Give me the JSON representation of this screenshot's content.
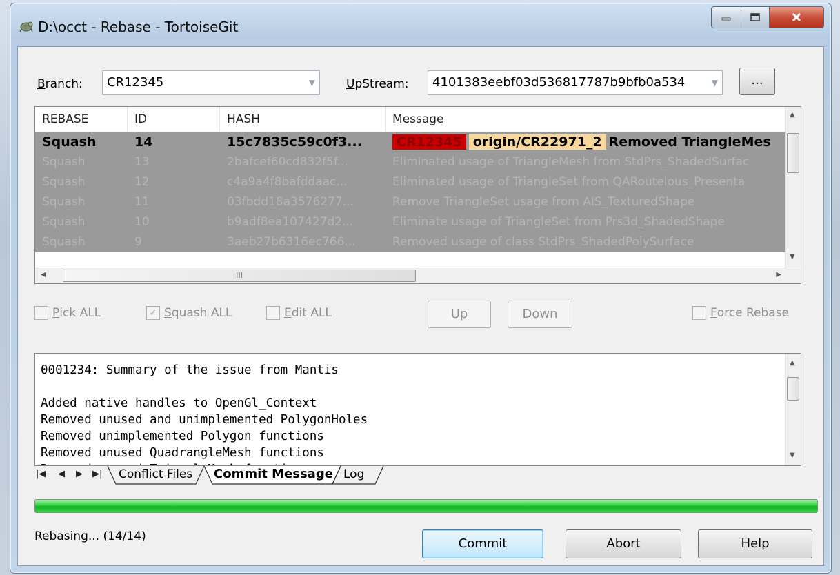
{
  "window": {
    "title": "D:\\occt - Rebase - TortoiseGit",
    "controls": {
      "minimize": "–",
      "maximize": "□",
      "close": "X"
    }
  },
  "branch": {
    "label_u": "B",
    "label_rest": "ranch:",
    "value": "CR12345"
  },
  "upstream": {
    "label_u": "U",
    "label_rest": "pStream:",
    "value": "4101383eebf03d536817787b9bfb0a534",
    "browse_label": "..."
  },
  "list": {
    "columns": [
      "REBASE",
      "ID",
      "HASH",
      "Message"
    ],
    "rows": [
      {
        "action": "Squash",
        "id": "14",
        "hash": "15c7835c59c0f3...",
        "tag1": "CR12345",
        "tag2": "origin/CR22971_2",
        "message": "Removed TriangleMes"
      },
      {
        "action": "Squash",
        "id": "13",
        "hash": "2bafcef60cd832f5f...",
        "message": "Eliminated usage of TriangleMesh from StdPrs_ShadedSurfac"
      },
      {
        "action": "Squash",
        "id": "12",
        "hash": "c4a9a4f8bafddaac...",
        "message": "Eliminated usage of TriangleSet from  QARoutelous_Presenta"
      },
      {
        "action": "Squash",
        "id": "11",
        "hash": "03fbdd18a3576277...",
        "message": "Remove TriangleSet usage from AIS_TexturedShape"
      },
      {
        "action": "Squash",
        "id": "10",
        "hash": "b9adf8ea107427d2...",
        "message": "Eliminate usage of TriangleSet from Prs3d_ShadedShape"
      },
      {
        "action": "Squash",
        "id": "9",
        "hash": "3aeb27b6316ec766...",
        "message": "Removed usage of class StdPrs_ShadedPolySurface"
      }
    ],
    "hscroll_marker": "III"
  },
  "options": {
    "pick_all": {
      "u": "P",
      "rest": "ick ALL"
    },
    "squash_all": {
      "u": "S",
      "rest": "quash ALL"
    },
    "edit_all": {
      "u": "E",
      "rest": "dit ALL"
    },
    "up_label": "Up",
    "down_label": "Down",
    "force_rebase": {
      "u": "F",
      "rest": "orce Rebase"
    }
  },
  "commit_message": {
    "text": "0001234: Summary of the issue from Mantis\n\nAdded native handles to OpenGl_Context\nRemoved unused and unimplemented PolygonHoles\nRemoved unimplemented Polygon functions\nRemoved unused QuadrangleMesh functions\nRemoved unused TriangleMesh functions"
  },
  "tabs": {
    "nav": [
      "|◀",
      "◀",
      "▶",
      "▶|"
    ],
    "items": [
      "Conflict Files",
      "Commit Message",
      "Log"
    ],
    "active": "Commit Message"
  },
  "progress": {
    "fraction": 1.0
  },
  "status": {
    "text": "Rebasing... (14/14)"
  },
  "buttons": {
    "commit": "Commit",
    "abort": "Abort",
    "help": "Help"
  }
}
